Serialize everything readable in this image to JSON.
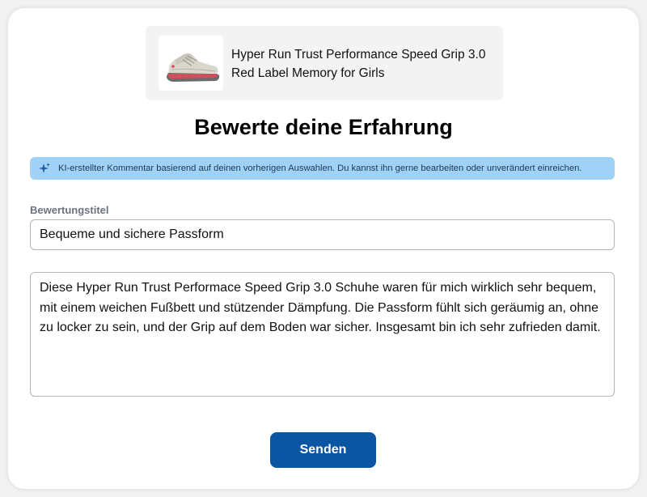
{
  "product": {
    "name": "Hyper Run Trust Performance Speed Grip 3.0 Red Label Memory for Girls",
    "image_icon": "sneaker-icon"
  },
  "page_title": "Bewerte deine Erfahrung",
  "ai_banner": {
    "icon": "sparkle-icon",
    "text": "KI-erstellter Kommentar basierend auf deinen vorherigen Auswahlen. Du kannst ihn gerne bearbeiten oder unverändert einreichen."
  },
  "review": {
    "title_label": "Bewertungstitel",
    "title_value": "Bequeme und sichere Passform",
    "comment_value": "Diese Hyper Run Trust Performace Speed Grip 3.0 Schuhe waren für mich wirklich sehr bequem, mit einem weichen Fußbett und stützender Dämpfung. Die Passform fühlt sich geräumig an, ohne zu locker zu sein, und der Grip auf dem Boden war sicher. Insgesamt bin ich sehr zufrieden damit."
  },
  "submit_label": "Senden",
  "colors": {
    "primary": "#0b56a2",
    "banner": "#9fd2f6",
    "shoe_accent": "#e0475b"
  }
}
